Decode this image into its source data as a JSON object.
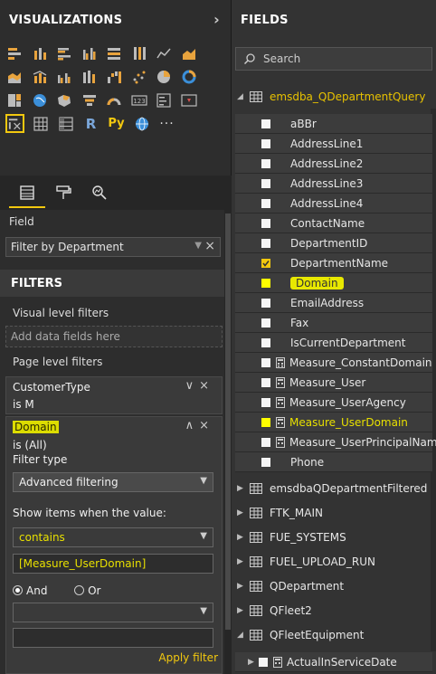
{
  "visualizations": {
    "title": "VISUALIZATIONS",
    "fields_tab_label": "Field",
    "field_value": "Filter by Department",
    "icon_rows": [
      [
        "stacked-bar-icon",
        "stacked-column-icon",
        "clustered-bar-icon",
        "clustered-column-icon",
        "100pct-bar-icon",
        "100pct-column-icon",
        "line-chart-icon",
        "area-chart-icon"
      ],
      [
        "stacked-area-icon",
        "line-column-icon",
        "line-clustered-icon",
        "ribbon-icon",
        "waterfall-icon",
        "scatter-icon",
        "pie-chart-icon",
        "donut-icon"
      ],
      [
        "treemap-icon",
        "map-icon",
        "filled-map-icon",
        "funnel-icon",
        "gauge-icon",
        "card-icon",
        "multirow-card-icon",
        "kpi-icon"
      ],
      [
        "slicer-icon",
        "table-icon",
        "matrix-icon",
        "r-visual-icon",
        "python-visual-icon",
        "globe-icon",
        "more-icon"
      ]
    ]
  },
  "filters": {
    "title": "FILTERS",
    "visual_level": "Visual level filters",
    "add_placeholder": "Add data fields here",
    "page_level": "Page level filters",
    "card1": {
      "name": "CustomerType",
      "value": "is M"
    },
    "card2": {
      "name": "Domain",
      "value": "is (All)",
      "filter_type_label": "Filter type",
      "filter_type": "Advanced filtering",
      "show_items_label": "Show items when the value:",
      "operator": "contains",
      "operand": "[Measure_UserDomain]",
      "and_label": "And",
      "or_label": "Or",
      "apply_label": "Apply filter"
    }
  },
  "fields": {
    "title": "FIELDS",
    "search_placeholder": "Search",
    "tables": [
      "emsdba_QDepartmentQuery",
      "emsdbaQDepartmentFiltered",
      "FTK_MAIN",
      "FUE_SYSTEMS",
      "FUEL_UPLOAD_RUN",
      "QDepartment",
      "QFleet2",
      "QFleetEquipment"
    ],
    "columns": [
      "aBBr",
      "AddressLine1",
      "AddressLine2",
      "AddressLine3",
      "AddressLine4",
      "ContactName",
      "DepartmentID",
      "DepartmentName",
      "Domain",
      "EmailAddress",
      "Fax",
      "IsCurrentDepartment",
      "Measure_ConstantDomain",
      "Measure_User",
      "Measure_UserAgency",
      "Measure_UserDomain",
      "Measure_UserPrincipalName",
      "Phone"
    ],
    "last_column": "ActualInServiceDate"
  },
  "colors": {
    "accent": "#f2c80f",
    "highlight": "#ffff00"
  }
}
